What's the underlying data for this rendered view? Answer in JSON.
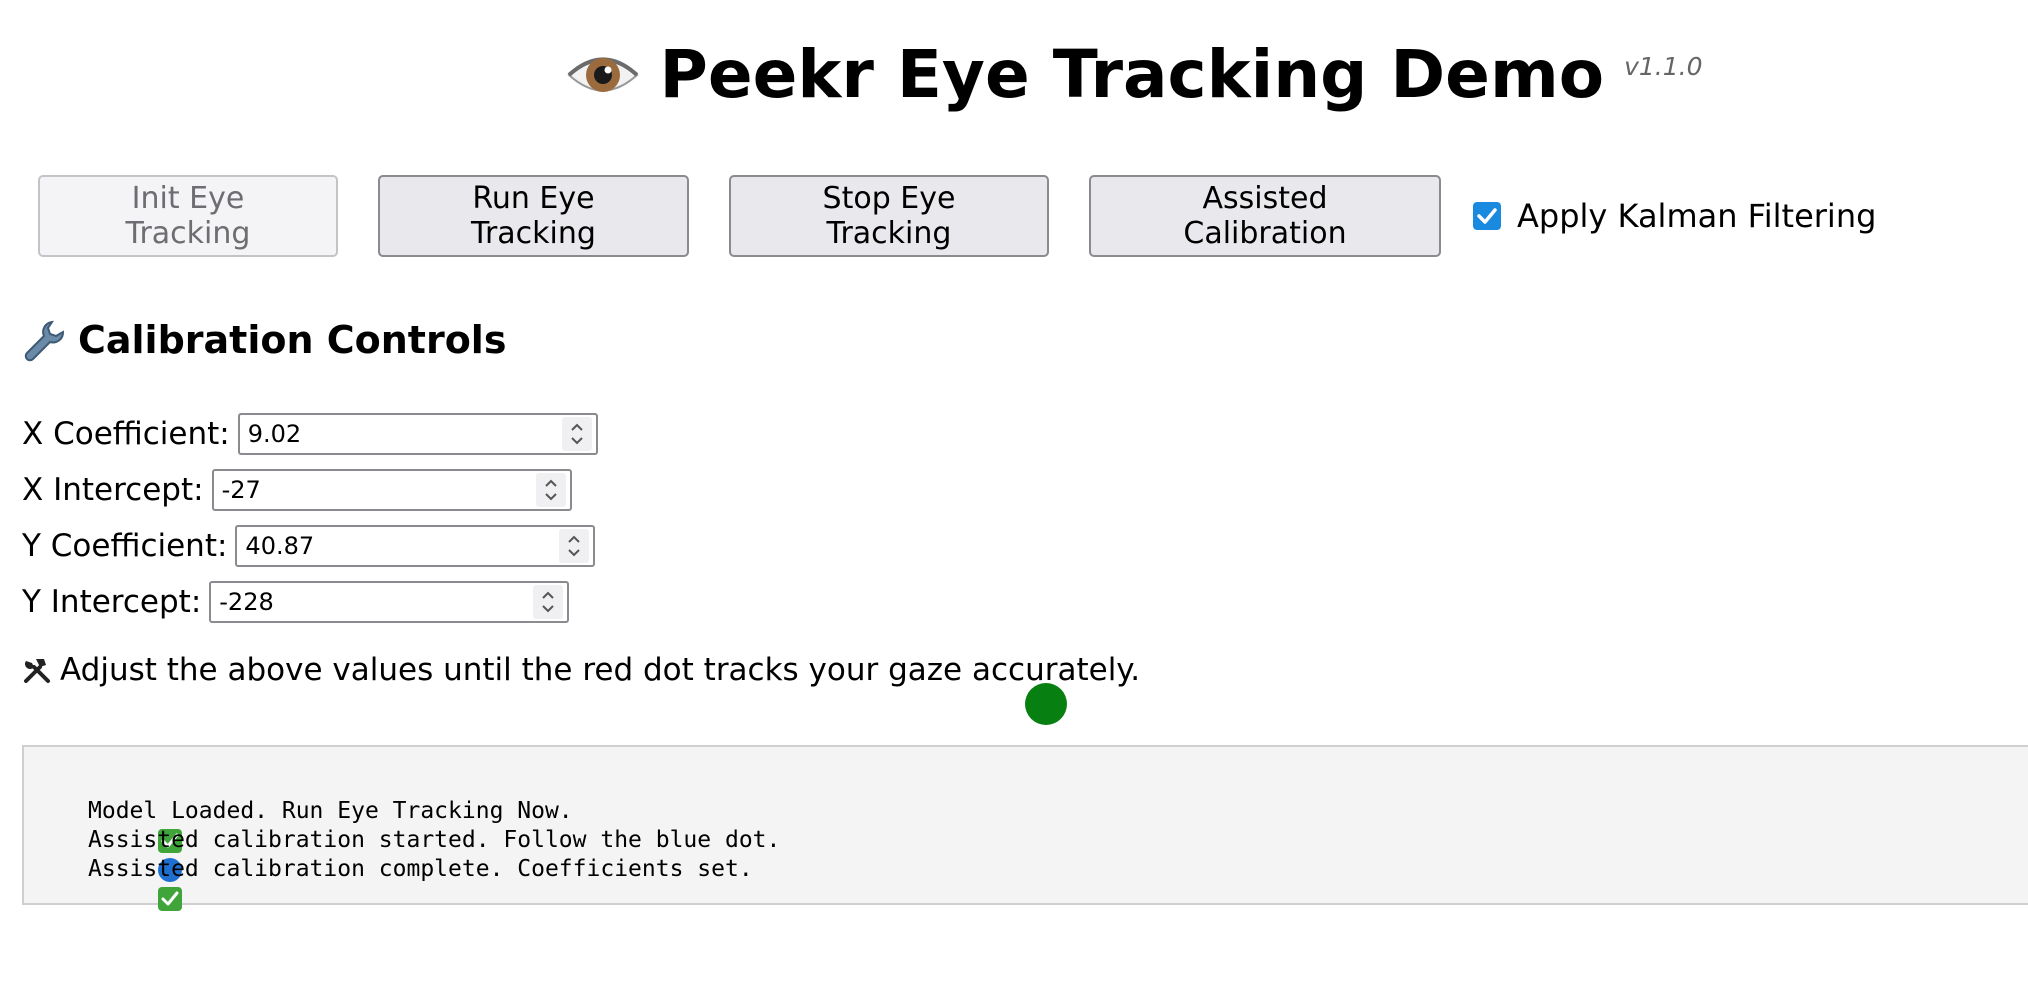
{
  "header": {
    "title": "Peekr Eye Tracking Demo",
    "version": "v1.1.0",
    "icon": "eye-icon"
  },
  "toolbar": {
    "init_label": "Init Eye Tracking",
    "init_disabled": true,
    "run_label": "Run Eye Tracking",
    "stop_label": "Stop Eye Tracking",
    "calibrate_label": "Assisted Calibration",
    "kalman_label": "Apply Kalman Filtering",
    "kalman_checked": true
  },
  "calibration": {
    "title": "Calibration Controls",
    "icon": "wrench-icon",
    "fields": [
      {
        "label": "X Coefficient:",
        "value": "9.02"
      },
      {
        "label": "X Intercept:",
        "value": "-27"
      },
      {
        "label": "Y Coefficient:",
        "value": "40.87"
      },
      {
        "label": "Y Intercept:",
        "value": "-228"
      }
    ],
    "hint": "Adjust the above values until the red dot tracks your gaze accurately.",
    "hint_icon": "tools-icon"
  },
  "gaze": {
    "dot_color": "#078011"
  },
  "log": {
    "lines": [
      {
        "icon": "check-icon",
        "text": "Model Loaded. Run Eye Tracking Now."
      },
      {
        "icon": "blue-circle-icon",
        "text": "Assisted calibration started. Follow the blue dot."
      },
      {
        "icon": "check-icon",
        "text": "Assisted calibration complete. Coefficients set."
      }
    ]
  },
  "colors": {
    "accent": "#1a8ae0",
    "check_green": "#3fa53a",
    "blue_circle": "#1f6fd1"
  }
}
